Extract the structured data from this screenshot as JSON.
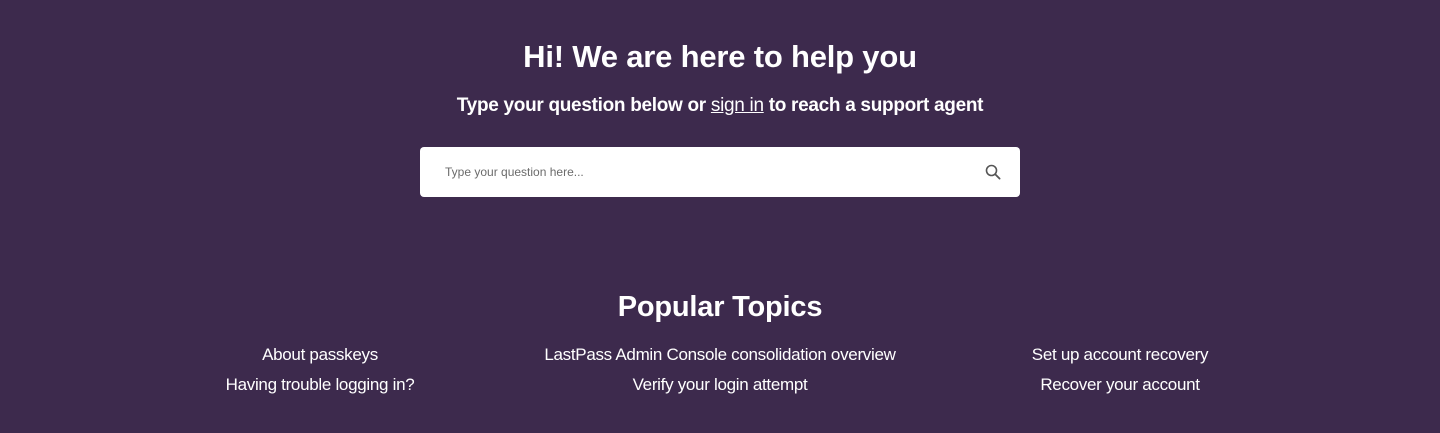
{
  "hero": {
    "title": "Hi! We are here to help you",
    "subtitle_before": "Type your question below or ",
    "sign_in_link": "sign in",
    "subtitle_after": " to reach a support agent"
  },
  "search": {
    "placeholder": "Type your question here...",
    "value": "",
    "icon": "search-icon"
  },
  "popular_topics": {
    "title": "Popular Topics",
    "columns": [
      [
        "About passkeys",
        "Having trouble logging in?"
      ],
      [
        "LastPass Admin Console consolidation overview",
        "Verify your login attempt"
      ],
      [
        "Set up account recovery",
        "Recover your account"
      ]
    ]
  },
  "colors": {
    "background": "#3d2a4d",
    "text": "#ffffff",
    "search_background": "#ffffff"
  }
}
